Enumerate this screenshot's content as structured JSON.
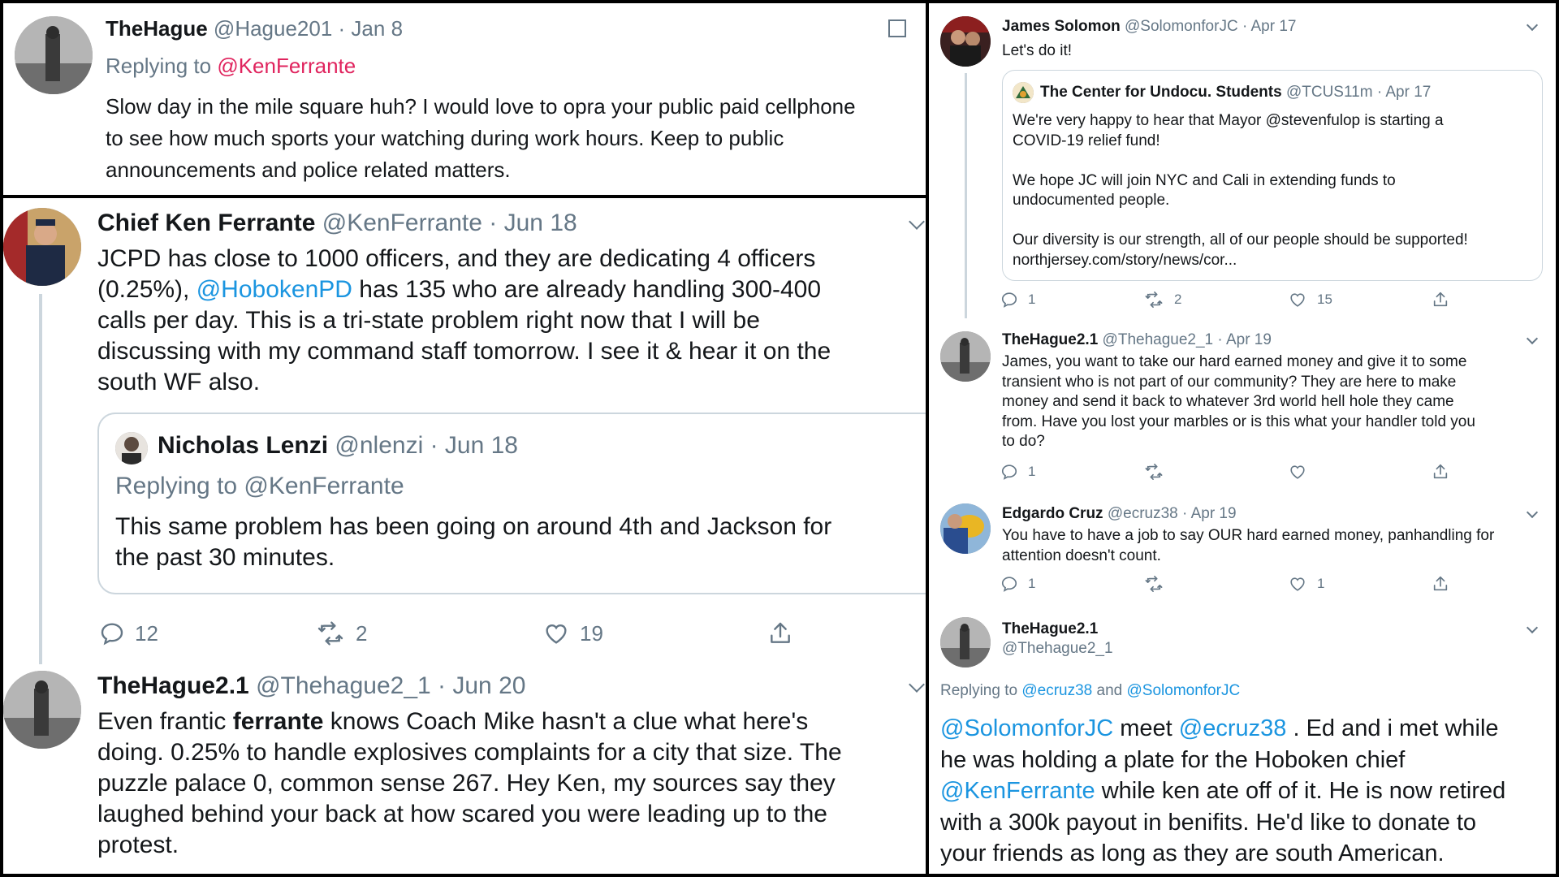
{
  "panel_a": {
    "name": "TheHague",
    "handle": "@Hague201",
    "date": "· Jan 8",
    "replying_prefix": "Replying to",
    "replying_to": "@KenFerrante",
    "body_line1": "Slow day in the mile square huh? I would love to opra your public paid cellphone",
    "body_line2": "to see how much sports your watching during work hours. Keep to public",
    "body_line3": "announcements and police related matters."
  },
  "panel_b": {
    "tweet": {
      "name": "Chief Ken Ferrante",
      "handle": "@KenFerrante",
      "date": "· Jun 18",
      "line1": "JCPD has close to 1000 officers, and they are dedicating 4 officers",
      "line2_pre": "(0.25%), ",
      "line2_link": "@HobokenPD",
      "line2_post": " has 135 who are already handling 300-400",
      "line3": "calls per day. This is a tri-state problem right now that I will be",
      "line4": "discussing with my command staff tomorrow. I see it & hear it on the",
      "line5": "south WF also."
    },
    "quoted": {
      "name": "Nicholas Lenzi",
      "handle": "@nlenzi",
      "date": "· Jun 18",
      "replying": "Replying to @KenFerrante",
      "line1": "This same problem has been going on around 4th and Jackson for",
      "line2": "the past 30 minutes."
    },
    "actions": {
      "replies": "12",
      "retweets": "2",
      "likes": "19"
    },
    "reply": {
      "name": "TheHague2.1",
      "handle": "@Thehague2_1",
      "date": "· Jun 20",
      "line1_pre": "Even frantic ",
      "line1_bold": "ferrante",
      "line1_post": " knows Coach Mike hasn't a clue what here's",
      "line2": "doing. 0.25% to handle explosives complaints for a city that size. The",
      "line3": "puzzle palace 0, common sense 267. Hey Ken, my sources say they",
      "line4": "laughed behind your back at how scared you were leading up to the",
      "line5": "protest."
    }
  },
  "panel_c": {
    "t1": {
      "name": "James Solomon",
      "handle": "@SolomonforJC",
      "date": "· Apr 17",
      "body": "Let's do it!",
      "actions": {
        "replies": "1",
        "retweets": "2",
        "likes": "15"
      }
    },
    "quote": {
      "name": "The Center for Undocu. Students",
      "handle": "@TCUS11m",
      "date": "· Apr 17",
      "p1_line1": "We're very happy to hear that Mayor @stevenfulop is starting a",
      "p1_line2": "COVID-19 relief fund!",
      "p2_line1": "We hope JC will join NYC and Cali in extending funds to",
      "p2_line2": "undocumented people.",
      "p3_line1": "Our diversity is our strength, all of our people should be supported!",
      "p3_line2": "northjersey.com/story/news/cor..."
    },
    "t2": {
      "name": "TheHague2.1",
      "handle": "@Thehague2_1",
      "date": "· Apr 19",
      "line1": "James, you want to take our hard earned money and give it to some",
      "line2": "transient who is not part of our community? They are here to make",
      "line3": "money and send it back to whatever 3rd world hell hole they came",
      "line4": "from. Have you lost your marbles or is this what your handler told you",
      "line5": "to do?",
      "actions": {
        "replies": "1"
      }
    },
    "t3": {
      "name": "Edgardo Cruz",
      "handle": "@ecruz38",
      "date": "· Apr 19",
      "line1": "You have to have a job to say OUR hard earned money, panhandling for",
      "line2": "attention doesn't count.",
      "actions": {
        "replies": "1",
        "likes": "1"
      }
    },
    "t4": {
      "name": "TheHague2.1",
      "handle": "@Thehague2_1",
      "replying_prefix": "Replying to ",
      "replying_a": "@ecruz38",
      "replying_and": " and ",
      "replying_b": "@SolomonforJC",
      "l1_link_a": "@SolomonforJC",
      "l1_meet": " meet ",
      "l1_link_b": "@ecruz38",
      "l1_post": " . Ed and i met while",
      "line2": "he was holding a plate for the Hoboken chief",
      "l3_link": "@KenFerrante",
      "l3_post": " while ken ate off of it. He is now retired",
      "line4": "with a 300k payout in benifits. He'd like to donate to",
      "line5": "your friends as long as they are south American."
    }
  },
  "icons": {
    "reply": "reply-icon",
    "retweet": "retweet-icon",
    "like": "heart-icon",
    "share": "share-icon",
    "more": "chevron-down-icon",
    "bookmark": "square-icon"
  },
  "colors": {
    "link": "#1b95e0",
    "muted": "#657786",
    "text": "#14171a",
    "divider": "#ccd6dd"
  }
}
